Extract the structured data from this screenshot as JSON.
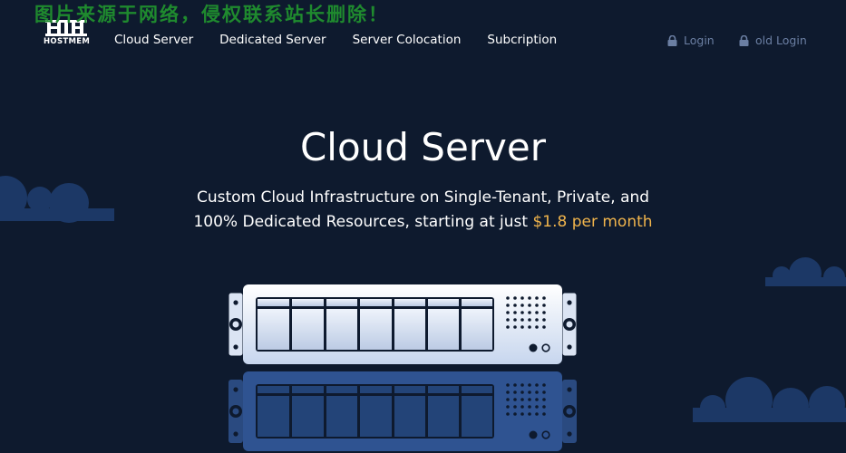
{
  "watermark": "图片来源于网络，侵权联系站长删除！",
  "brand": {
    "name": "HOSTMEM"
  },
  "nav": {
    "items": [
      "Cloud Server",
      "Dedicated Server",
      "Server Colocation",
      "Subcription"
    ]
  },
  "auth": {
    "login_label": "Login",
    "old_login_label": "old Login"
  },
  "hero": {
    "title": "Cloud Server",
    "subtitle_line1": "Custom Cloud Infrastructure on Single-Tenant, Private, and",
    "subtitle_line2_prefix": "100% Dedicated Resources, starting at just ",
    "price": "$1.8 per month"
  },
  "colors": {
    "background": "#0e1a2e",
    "price_accent": "#f0b44c",
    "watermark": "#1f8a2e",
    "muted_link": "#6b7fa3",
    "cloud": "#1c3866"
  },
  "icons": [
    "logo-icon",
    "lock-icon",
    "lock-icon",
    "server-illustration",
    "cloud-decoration"
  ]
}
